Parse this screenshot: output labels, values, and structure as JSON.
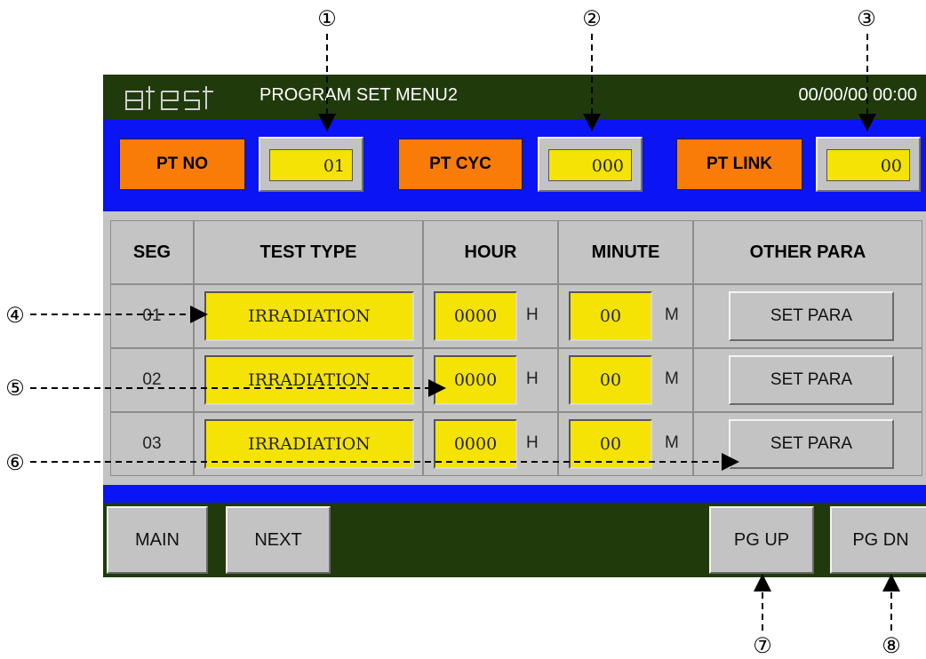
{
  "callouts": [
    "①",
    "②",
    "③",
    "④",
    "⑤",
    "⑥",
    "⑦",
    "⑧"
  ],
  "header": {
    "logo_text": "atest",
    "title": "PROGRAM SET MENU2",
    "datetime": "00/00/00 00:00"
  },
  "params": {
    "pt_no_label": "PT NO",
    "pt_no_value": "01",
    "pt_cyc_label": "PT CYC",
    "pt_cyc_value": "000",
    "pt_link_label": "PT LINK",
    "pt_link_value": "00"
  },
  "table": {
    "headers": [
      "SEG",
      "TEST TYPE",
      "HOUR",
      "MINUTE",
      "OTHER PARA"
    ],
    "rows": [
      {
        "seg": "01",
        "test_type": "IRRADIATION",
        "hour": "0000",
        "hour_unit": "H",
        "minute": "00",
        "minute_unit": "M",
        "button": "SET PARA"
      },
      {
        "seg": "02",
        "test_type": "IRRADIATION",
        "hour": "0000",
        "hour_unit": "H",
        "minute": "00",
        "minute_unit": "M",
        "button": "SET PARA"
      },
      {
        "seg": "03",
        "test_type": "IRRADIATION",
        "hour": "0000",
        "hour_unit": "H",
        "minute": "00",
        "minute_unit": "M",
        "button": "SET PARA"
      }
    ]
  },
  "nav": {
    "main": "MAIN",
    "next": "NEXT",
    "pg_up": "PG UP",
    "pg_dn": "PG DN"
  },
  "colors": {
    "title_bar": "#213a0b",
    "band_blue": "#0a14f4",
    "label_orange": "#f97c08",
    "value_yellow": "#f4e304",
    "panel_gray": "#c4c4c4"
  }
}
